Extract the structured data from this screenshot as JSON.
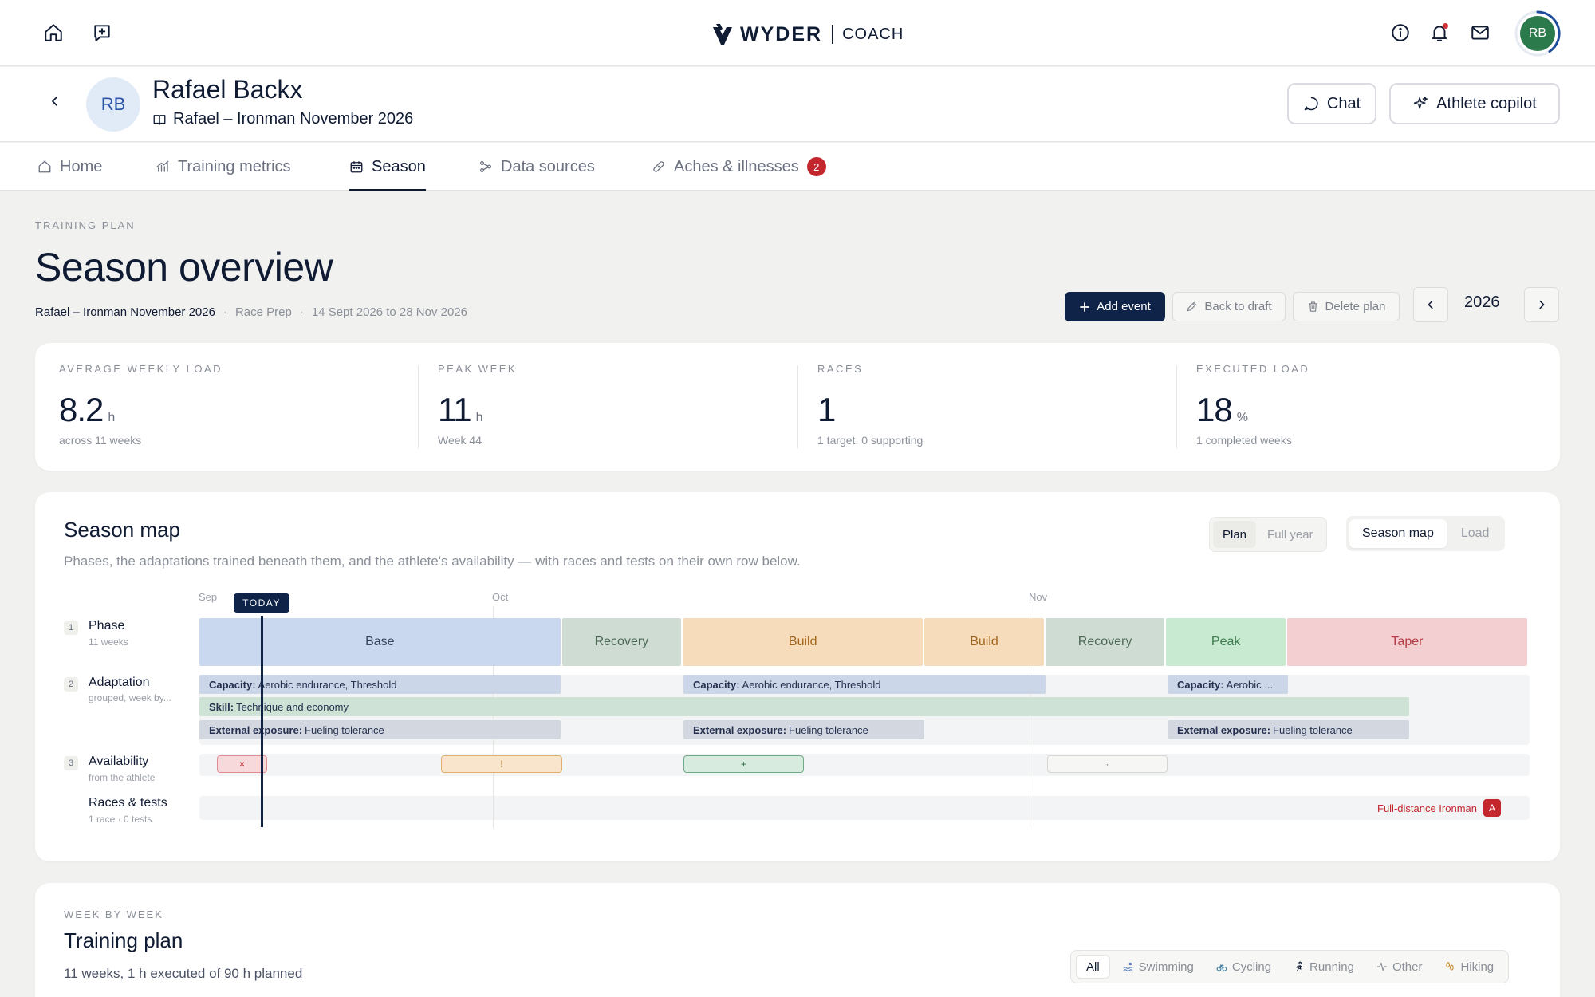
{
  "app": {
    "brand": "WYDER",
    "product": "COACH",
    "avatar_initials": "RB"
  },
  "athlete": {
    "initials": "RB",
    "name": "Rafael Backx",
    "plan_name": "Rafael – Ironman November 2026",
    "chat_label": "Chat",
    "copilot_label": "Athlete copilot"
  },
  "tabs": [
    {
      "label": "Home",
      "icon": "home-icon"
    },
    {
      "label": "Training metrics",
      "icon": "bar-chart-icon"
    },
    {
      "label": "Season",
      "icon": "calendar-icon",
      "active": true
    },
    {
      "label": "Data sources",
      "icon": "connections-icon"
    },
    {
      "label": "Aches & illnesses",
      "icon": "bandage-icon",
      "badge": "2"
    }
  ],
  "page": {
    "eyebrow": "TRAINING PLAN",
    "title": "Season overview",
    "meta": {
      "plan": "Rafael – Ironman November 2026",
      "sep": "·",
      "phase": "Race Prep",
      "dates": "14 Sept 2026 to 28 Nov 2026"
    },
    "actions": {
      "add_event": "Add event",
      "back_to_draft": "Back to draft",
      "delete_plan": "Delete plan"
    },
    "year": "2026"
  },
  "stats": [
    {
      "label": "AVERAGE WEEKLY LOAD",
      "value": "8.2",
      "unit": "h",
      "sub": "across 11 weeks"
    },
    {
      "label": "PEAK WEEK",
      "value": "11",
      "unit": "h",
      "sub": "Week 44"
    },
    {
      "label": "RACES",
      "value": "1",
      "unit": "",
      "sub": "1 target, 0 supporting"
    },
    {
      "label": "EXECUTED LOAD",
      "value": "18",
      "unit": "%",
      "sub": "1 completed weeks"
    }
  ],
  "season_map": {
    "title": "Season map",
    "subtitle": "Phases, the adaptations trained beneath them, and the athlete's availability — with races and tests on their own row below.",
    "range_toggle": {
      "options": [
        "Plan",
        "Full year"
      ],
      "selected": "Plan"
    },
    "view_toggle": {
      "options": [
        "Season map",
        "Load"
      ],
      "selected": "Season map"
    },
    "months": [
      "Sep",
      "Oct",
      "Nov"
    ],
    "today_label": "TODAY",
    "rows": [
      {
        "num": "1",
        "label": "Phase",
        "sub": "11 weeks"
      },
      {
        "num": "2",
        "label": "Adaptation",
        "sub": "grouped, week by..."
      },
      {
        "num": "3",
        "label": "Availability",
        "sub": "from the athlete"
      },
      {
        "num": "",
        "label": "Races & tests",
        "sub": "1 race · 0 tests"
      }
    ],
    "phases": [
      {
        "name": "Base",
        "weeks": 3,
        "color": "#c9d8ef",
        "text": "#3a4660"
      },
      {
        "name": "Recovery",
        "weeks": 1,
        "color": "#cfdcd3",
        "text": "#4c6a55"
      },
      {
        "name": "Build",
        "weeks": 2,
        "color": "#f6dcbb",
        "text": "#a0651d"
      },
      {
        "name": "Build",
        "weeks": 1,
        "color": "#f6dcbb",
        "text": "#a0651d"
      },
      {
        "name": "Recovery",
        "weeks": 1,
        "color": "#cfdcd3",
        "text": "#4c6a55"
      },
      {
        "name": "Peak",
        "weeks": 1,
        "color": "#c8ead0",
        "text": "#3d7b4f"
      },
      {
        "name": "Taper",
        "weeks": 2,
        "color": "#f3cfd2",
        "text": "#b53b45"
      }
    ],
    "adaptations": [
      {
        "label": "Capacity:",
        "text": "Aerobic endurance, Threshold"
      },
      {
        "label": "Capacity:",
        "text": "Aerobic endurance, Threshold"
      },
      {
        "label": "Capacity:",
        "text": "Aerobic ..."
      },
      {
        "label": "Skill:",
        "text": "Technique and economy"
      },
      {
        "label": "External exposure:",
        "text": "Fueling tolerance"
      },
      {
        "label": "External exposure:",
        "text": "Fueling tolerance"
      },
      {
        "label": "External exposure:",
        "text": "Fueling tolerance"
      }
    ],
    "availability": [
      {
        "symbol": "×",
        "kind": "unavailable"
      },
      {
        "symbol": "!",
        "kind": "limited"
      },
      {
        "symbol": "+",
        "kind": "extra"
      },
      {
        "symbol": "·",
        "kind": "note"
      }
    ],
    "race": {
      "name": "Full-distance Ironman",
      "priority": "A"
    }
  },
  "training_plan": {
    "eyebrow": "WEEK BY WEEK",
    "title": "Training plan",
    "summary": "11 weeks, 1 h executed of 90 h planned",
    "filters": [
      "All",
      "Swimming",
      "Cycling",
      "Running",
      "Other",
      "Hiking"
    ],
    "selected_filter": "All"
  }
}
